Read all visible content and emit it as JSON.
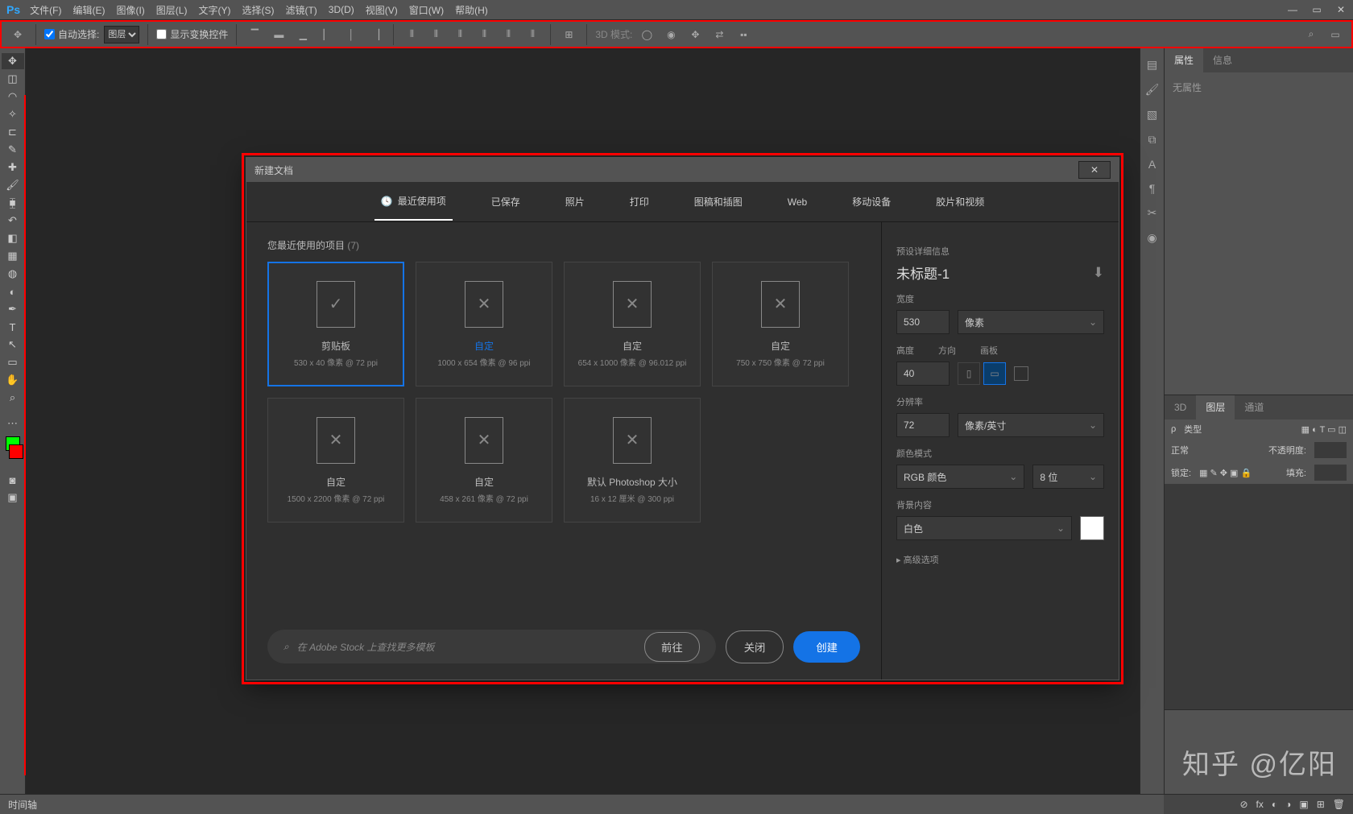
{
  "app": {
    "logo": "Ps"
  },
  "menu": [
    "文件(F)",
    "编辑(E)",
    "图像(I)",
    "图层(L)",
    "文字(Y)",
    "选择(S)",
    "滤镜(T)",
    "3D(D)",
    "视图(V)",
    "窗口(W)",
    "帮助(H)"
  ],
  "optbar": {
    "auto_select": "自动选择:",
    "target": "图层",
    "show_transform": "显示变换控件",
    "mode_3d": "3D 模式:"
  },
  "panels": {
    "props_tab": "属性",
    "info_tab": "信息",
    "no_props": "无属性",
    "d3_tab": "3D",
    "layers_tab": "图层",
    "channels_tab": "通道",
    "kind": "类型",
    "normal": "正常",
    "opacity": "不透明度:",
    "lock": "锁定:",
    "fill": "填充:"
  },
  "status": {
    "timeline": "时间轴"
  },
  "dialog": {
    "title": "新建文档",
    "tabs": [
      "最近使用项",
      "已保存",
      "照片",
      "打印",
      "图稿和插图",
      "Web",
      "移动设备",
      "胶片和视频"
    ],
    "active_tab": 0,
    "recent_label": "您最近使用的项目",
    "recent_count": "(7)",
    "presets": [
      {
        "name": "剪贴板",
        "meta": "530 x 40 像素 @ 72 ppi",
        "sel": true,
        "icon": "clipboard"
      },
      {
        "name": "自定",
        "meta": "1000 x 654 像素 @ 96 ppi",
        "blue": true
      },
      {
        "name": "自定",
        "meta": "654 x 1000 像素 @ 96.012 ppi"
      },
      {
        "name": "自定",
        "meta": "750 x 750 像素 @ 72 ppi"
      },
      {
        "name": "自定",
        "meta": "1500 x 2200 像素 @ 72 ppi"
      },
      {
        "name": "自定",
        "meta": "458 x 261 像素 @ 72 ppi"
      },
      {
        "name": "默认 Photoshop 大小",
        "meta": "16 x 12 厘米 @ 300 ppi"
      }
    ],
    "search_ph": "在 Adobe Stock 上查找更多模板",
    "go": "前往",
    "close": "关闭",
    "create": "创建",
    "details": {
      "header": "预设详细信息",
      "name": "未标题-1",
      "w_lbl": "宽度",
      "w": "530",
      "w_unit": "像素",
      "h_lbl": "高度",
      "h": "40",
      "orient_lbl": "方向",
      "artboard_lbl": "画板",
      "res_lbl": "分辨率",
      "res": "72",
      "res_unit": "像素/英寸",
      "mode_lbl": "颜色模式",
      "mode": "RGB 颜色",
      "bits": "8 位",
      "bg_lbl": "背景内容",
      "bg": "白色",
      "adv": "高级选项"
    }
  },
  "watermark": "知乎 @亿阳"
}
